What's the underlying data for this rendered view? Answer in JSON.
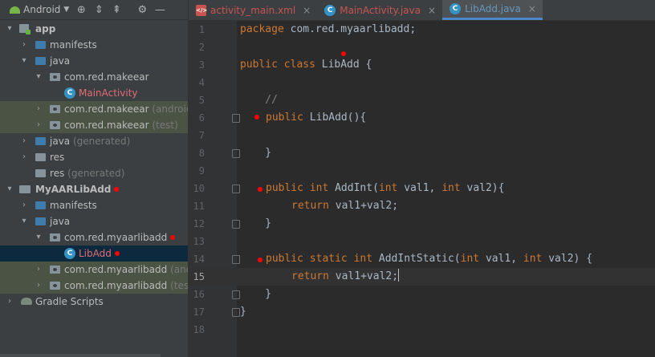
{
  "project": {
    "view_selector": "Android",
    "toolbar_icons": [
      "target-icon",
      "expand-icon",
      "collapse-icon",
      "gear-icon",
      "minimize-icon"
    ],
    "tree": [
      {
        "label": "app",
        "bold": true
      },
      {
        "label": "manifests"
      },
      {
        "label": "java"
      },
      {
        "label": "com.red.makeear"
      },
      {
        "label": "MainActivity"
      },
      {
        "label": "com.red.makeear",
        "suffix": "(androidTe"
      },
      {
        "label": "com.red.makeear",
        "suffix": "(test)"
      },
      {
        "label": "java",
        "suffix": "(generated)"
      },
      {
        "label": "res"
      },
      {
        "label": "res",
        "suffix": "(generated)"
      },
      {
        "label": "MyAARLibAdd",
        "bold": true
      },
      {
        "label": "manifests"
      },
      {
        "label": "java"
      },
      {
        "label": "com.red.myaarlibadd"
      },
      {
        "label": "LibAdd"
      },
      {
        "label": "com.red.myaarlibadd",
        "suffix": "(andro"
      },
      {
        "label": "com.red.myaarlibadd",
        "suffix": "(test)"
      },
      {
        "label": "Gradle Scripts"
      }
    ]
  },
  "tabs": [
    {
      "label": "activity_main.xml",
      "icon": "xml-file-icon",
      "close": "×"
    },
    {
      "label": "MainActivity.java",
      "icon": "class-icon",
      "close": "×"
    },
    {
      "label": "LibAdd.java",
      "icon": "class-icon",
      "close": "×",
      "active": true
    }
  ],
  "editor": {
    "line_numbers": [
      "1",
      "2",
      "3",
      "4",
      "5",
      "6",
      "7",
      "8",
      "9",
      "10",
      "11",
      "12",
      "13",
      "14",
      "15",
      "16",
      "17",
      "18"
    ],
    "current_line": 15,
    "code": {
      "l1_kw": "package",
      "l1_rest": " com.red.myaarlibadd;",
      "l3_kw": "public class",
      "l3_rest": " LibAdd {",
      "l5": "    //",
      "l6_kw": "public",
      "l6_rest": " LibAdd(){",
      "l8": "    }",
      "l10_kw1": "public int",
      "l10_mid1": " AddInt(",
      "l10_kw2": "int",
      "l10_mid2": " val1, ",
      "l10_kw3": "int",
      "l10_rest": " val2){",
      "l11_kw": "return",
      "l11_rest": " val1+val2;",
      "l12": "    }",
      "l14_kw1": "public static int",
      "l14_mid1": " AddIntStatic(",
      "l14_kw2": "int",
      "l14_mid2": " val1, ",
      "l14_kw3": "int",
      "l14_rest": " val2) {",
      "l15_kw": "return",
      "l15_rest": " val1+val2;",
      "l16": "    }",
      "l17": "}"
    }
  },
  "colors": {
    "keyword": "#cc7832",
    "comment": "#808080",
    "text": "#a9b7c6",
    "breakpoint_marker": "#ff0000",
    "highlight_row": "#4b5345",
    "selected_row": "#0d293e"
  }
}
